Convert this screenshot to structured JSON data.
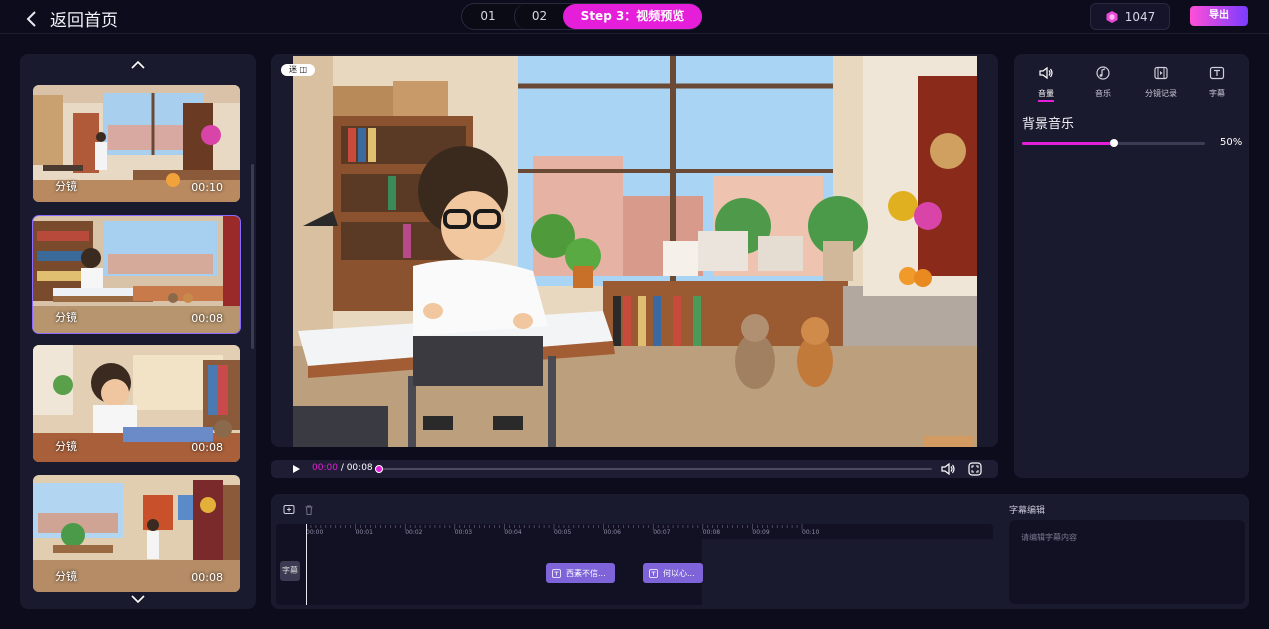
{
  "header": {
    "back_label": "返回首页",
    "steps": [
      "01",
      "02",
      "Step 3：视频预览"
    ],
    "credits": "1047",
    "export_label": "导出"
  },
  "shots": [
    {
      "label": "分镜",
      "duration": "00:10",
      "selected": false
    },
    {
      "label": "分镜",
      "duration": "00:08",
      "selected": true
    },
    {
      "label": "分镜",
      "duration": "00:08",
      "selected": false
    },
    {
      "label": "分镜",
      "duration": "00:08",
      "selected": false
    }
  ],
  "player": {
    "badge": "迷 ◫",
    "current_time": "00:00",
    "total_time": "/ 00:08",
    "progress": 0
  },
  "side_tabs": [
    {
      "label": "音量",
      "icon": "volume-icon",
      "active": true
    },
    {
      "label": "音乐",
      "icon": "music-icon",
      "active": false
    },
    {
      "label": "分镜记录",
      "icon": "storyboard-icon",
      "active": false
    },
    {
      "label": "字幕",
      "icon": "subtitle-icon",
      "active": false
    }
  ],
  "volume": {
    "title": "背景音乐",
    "value_label": "50%",
    "value": 0.5
  },
  "timeline": {
    "ticks": [
      "00:00",
      "00:01",
      "00:02",
      "00:03",
      "00:04",
      "00:05",
      "00:06",
      "00:07",
      "00:08",
      "00:09",
      "00:10"
    ],
    "track_label": "字幕",
    "clips": [
      {
        "text": "西素不信..."
      },
      {
        "text": "何以心..."
      }
    ]
  },
  "subtitle_editor": {
    "title": "字幕编辑",
    "placeholder": "请编辑字幕内容"
  },
  "colors": {
    "accent": "#e51fd9",
    "clip": "#7e64d8",
    "background": "#0d0c1d",
    "panel": "#1a1a2e"
  }
}
